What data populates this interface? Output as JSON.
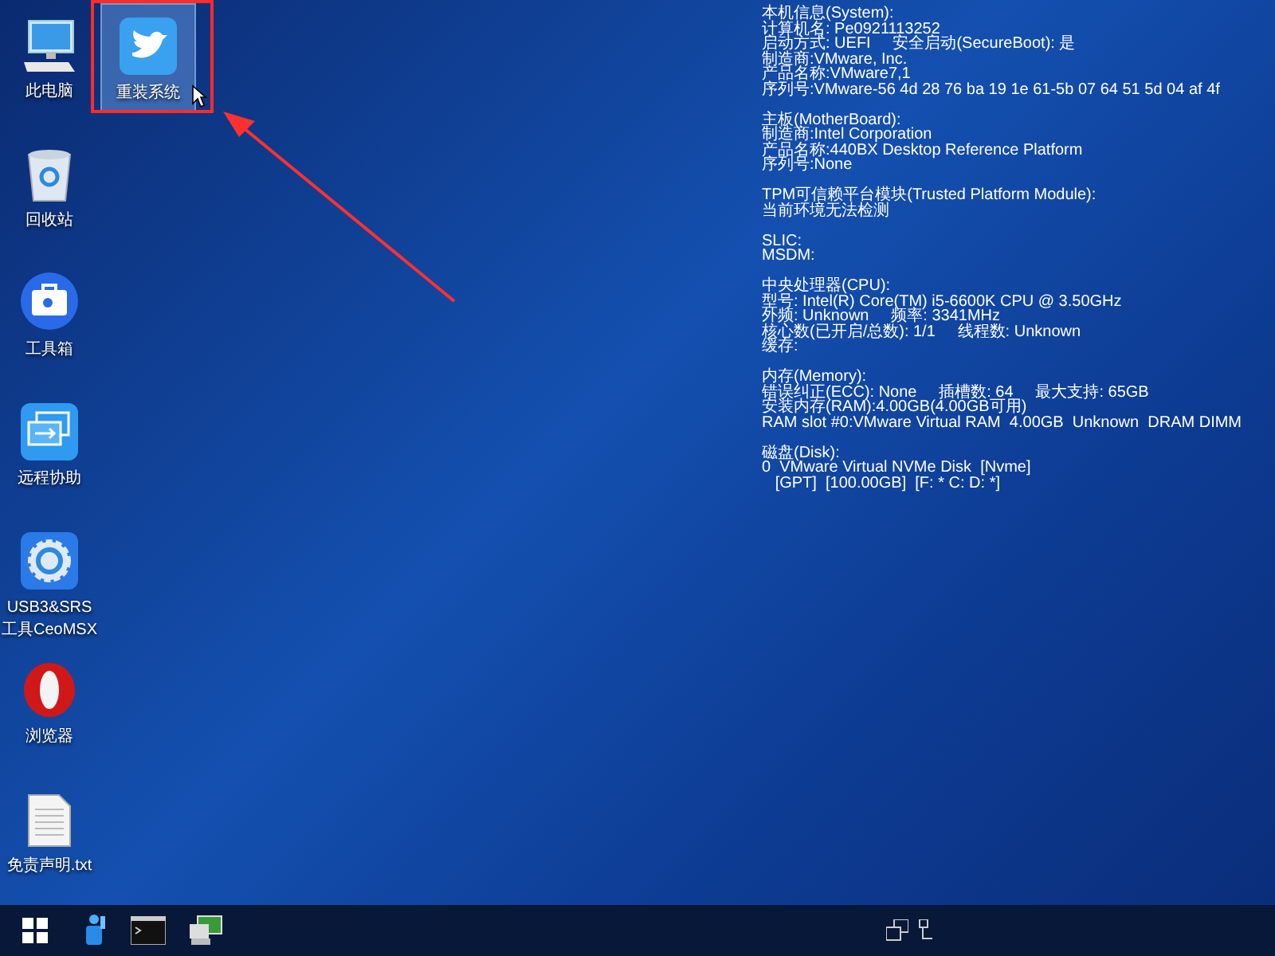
{
  "desktop_icons": [
    {
      "label": "此电脑",
      "kind": "computer",
      "selected": false
    },
    {
      "label": "回收站",
      "kind": "recycle_bin",
      "selected": false
    },
    {
      "label": "工具箱",
      "kind": "toolbox",
      "selected": false
    },
    {
      "label": "远程协助",
      "kind": "remote",
      "selected": false
    },
    {
      "label": "USB3&SRS\n工具CeoMSX",
      "kind": "gear_app",
      "selected": false
    },
    {
      "label": "浏览器",
      "kind": "browser",
      "selected": false
    },
    {
      "label": "免责声明.txt",
      "kind": "text_file",
      "selected": false
    },
    {
      "label": "重装系统",
      "kind": "bird_app",
      "selected": true
    }
  ],
  "system_info": [
    {
      "lines": [
        "本机信息(System):",
        "计算机名: Pe0921113252",
        "启动方式: UEFI     安全启动(SecureBoot): 是",
        "制造商:VMware, Inc.",
        "产品名称:VMware7,1",
        "序列号:VMware-56 4d 28 76 ba 19 1e 61-5b 07 64 51 5d 04 af 4f"
      ]
    },
    {
      "lines": [
        "主板(MotherBoard):",
        "制造商:Intel Corporation",
        "产品名称:440BX Desktop Reference Platform",
        "序列号:None"
      ]
    },
    {
      "lines": [
        "TPM可信赖平台模块(Trusted Platform Module):",
        "当前环境无法检测"
      ]
    },
    {
      "lines": [
        "SLIC:",
        "MSDM:"
      ]
    },
    {
      "lines": [
        "中央处理器(CPU):",
        "型号: Intel(R) Core(TM) i5-6600K CPU @ 3.50GHz",
        "外频: Unknown     频率: 3341MHz",
        "核心数(已开启/总数): 1/1     线程数: Unknown",
        "缓存:"
      ]
    },
    {
      "lines": [
        "内存(Memory):",
        "错误纠正(ECC): None     插槽数: 64     最大支持: 65GB",
        "安装内存(RAM):4.00GB(4.00GB可用)",
        "RAM slot #0:VMware Virtual RAM  4.00GB  Unknown  DRAM DIMM"
      ]
    },
    {
      "lines": [
        "磁盘(Disk):",
        "0  VMware Virtual NVMe Disk  [Nvme]",
        "   [GPT]  [100.00GB]  [F: * C: D: *]"
      ]
    }
  ],
  "taskbar": {
    "items": [
      {
        "kind": "start"
      },
      {
        "kind": "tool"
      },
      {
        "kind": "terminal"
      },
      {
        "kind": "network_computer"
      }
    ],
    "tray": [
      {
        "kind": "windows_pair"
      },
      {
        "kind": "network"
      }
    ]
  }
}
